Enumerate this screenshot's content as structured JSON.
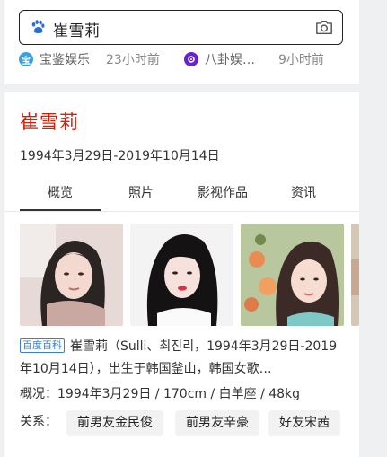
{
  "search": {
    "query": "崔雪莉",
    "icon": "baidu-paw-icon",
    "camera_icon": "camera-icon"
  },
  "news": [
    {
      "source": "宝鉴娱乐",
      "time": "23小时前",
      "icon_color": "#3aa0e6"
    },
    {
      "source": "八卦娱…",
      "time": "9小时前",
      "icon_color": "#6b1fd1"
    }
  ],
  "person": {
    "name": "崔雪莉",
    "dates": "1994年3月29日-2019年10月14日"
  },
  "tabs": [
    "概览",
    "照片",
    "影视作品",
    "资讯"
  ],
  "active_tab": "概览",
  "description": {
    "tag": "百度百科",
    "text": "崔雪莉（Sulli、최진리，1994年3月29日-2019年10月14日），出生于韩国釜山，韩国女歌…"
  },
  "overview": "概况：1994年3月29日  /  170cm  /  白羊座  /  48kg",
  "relations": {
    "label": "关系：",
    "chips": [
      "前男友金民俊",
      "前男友辛豪",
      "好友宋茜"
    ]
  },
  "colors": {
    "name": "#d81e06",
    "tag": "#3b7cd6"
  }
}
